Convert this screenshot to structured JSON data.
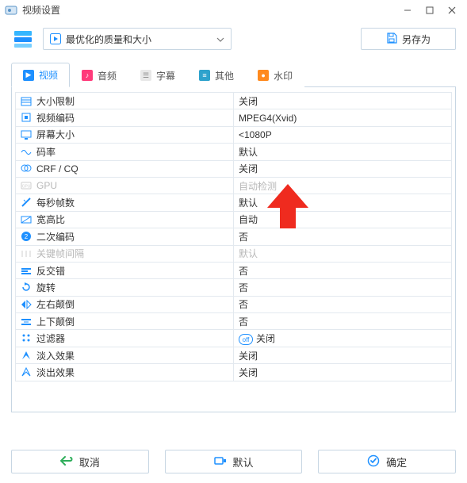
{
  "window": {
    "title": "视频设置"
  },
  "topbar": {
    "preset_label": "最优化的质量和大小",
    "save_as_label": "另存为"
  },
  "tabs": [
    {
      "id": "video",
      "label": "视频",
      "active": true
    },
    {
      "id": "audio",
      "label": "音频",
      "active": false
    },
    {
      "id": "subtitle",
      "label": "字幕",
      "active": false
    },
    {
      "id": "other",
      "label": "其他",
      "active": false
    },
    {
      "id": "watermark",
      "label": "水印",
      "active": false
    }
  ],
  "rows": [
    {
      "icon": "size-limit-icon",
      "label": "大小限制",
      "value": "关闭"
    },
    {
      "icon": "codec-icon",
      "label": "视频编码",
      "value": "MPEG4(Xvid)"
    },
    {
      "icon": "screen-size-icon",
      "label": "屏幕大小",
      "value": "<1080P"
    },
    {
      "icon": "bitrate-icon",
      "label": "码率",
      "value": "默认"
    },
    {
      "icon": "crf-icon",
      "label": "CRF / CQ",
      "value": "关闭"
    },
    {
      "icon": "gpu-icon",
      "label": "GPU",
      "value": "自动检测",
      "disabled": true
    },
    {
      "icon": "fps-icon",
      "label": "每秒帧数",
      "value": "默认"
    },
    {
      "icon": "aspect-icon",
      "label": "宽高比",
      "value": "自动"
    },
    {
      "icon": "twopass-icon",
      "label": "二次编码",
      "value": "否"
    },
    {
      "icon": "keyframe-icon",
      "label": "关键帧间隔",
      "value": "默认",
      "disabled": true
    },
    {
      "icon": "deinterlace-icon",
      "label": "反交错",
      "value": "否"
    },
    {
      "icon": "rotate-icon",
      "label": "旋转",
      "value": "否"
    },
    {
      "icon": "fliph-icon",
      "label": "左右颠倒",
      "value": "否"
    },
    {
      "icon": "flipv-icon",
      "label": "上下颠倒",
      "value": "否"
    },
    {
      "icon": "filter-icon",
      "label": "过滤器",
      "value": "关闭",
      "pill": true
    },
    {
      "icon": "fadein-icon",
      "label": "淡入效果",
      "value": "关闭"
    },
    {
      "icon": "fadeout-icon",
      "label": "淡出效果",
      "value": "关闭"
    }
  ],
  "footer": {
    "cancel": "取消",
    "default": "默认",
    "ok": "确定"
  }
}
